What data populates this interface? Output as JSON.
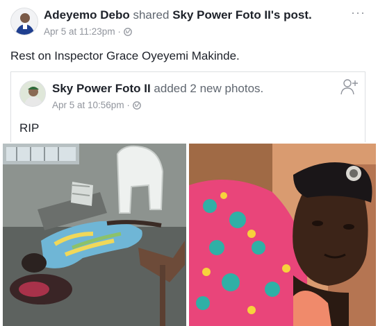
{
  "post": {
    "author": "Adeyemo Debo",
    "action": " shared ",
    "shared_from": "Sky Power Foto II",
    "shared_suffix": "'s post",
    "period": ".",
    "timestamp": "Apr 5 at 11:23pm",
    "separator": " · ",
    "privacy_icon": "globe-icon",
    "more_label": "···",
    "text": "Rest on Inspector Grace Oyeyemi Makinde."
  },
  "shared_post": {
    "author": "Sky Power Foto II",
    "action": " added 2 new photos.",
    "timestamp": "Apr 5 at 10:56pm",
    "separator": " · ",
    "privacy_icon": "globe-icon",
    "add_friend_icon": "add-friend-icon",
    "text": "RIP"
  },
  "photos": [
    {
      "name": "photo-body-on-floor"
    },
    {
      "name": "photo-portrait-with-beret"
    }
  ],
  "colors": {
    "primary_text": "#1d2129",
    "secondary_text": "#90949c",
    "border": "#dddfe2"
  }
}
